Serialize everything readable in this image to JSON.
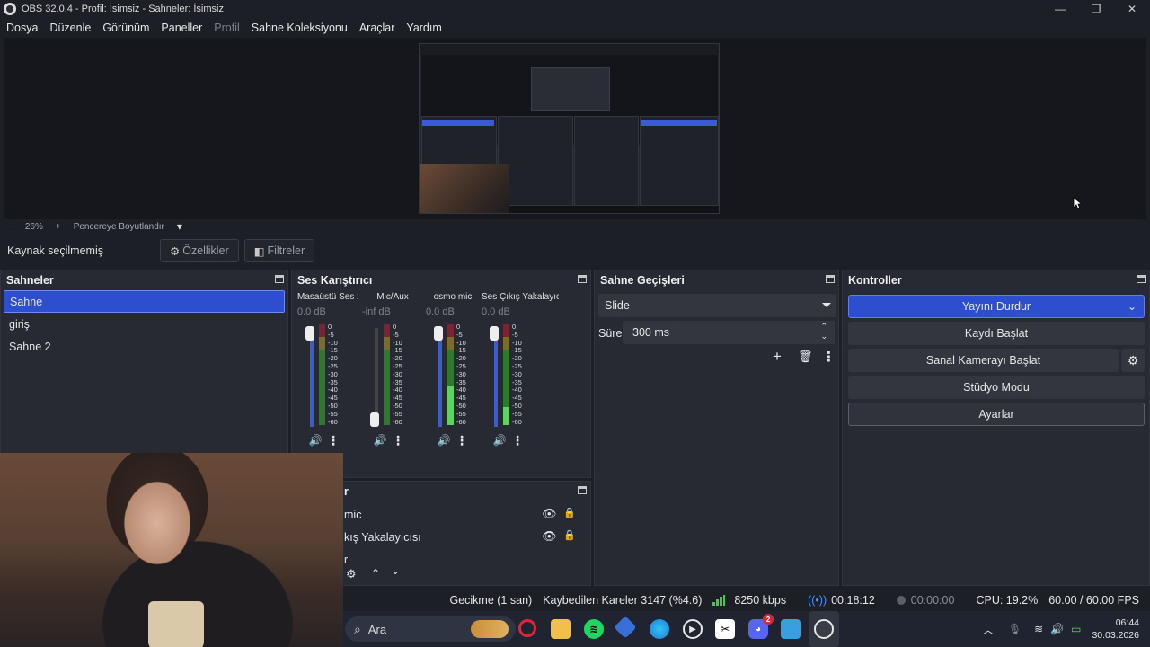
{
  "window": {
    "title": "OBS 32.0.4 - Profil: İsimsiz - Sahneler: İsimsiz",
    "minimize": "—",
    "maximize": "❐",
    "close": "✕"
  },
  "menu": {
    "items": [
      "Dosya",
      "Düzenle",
      "Görünüm",
      "Paneller",
      "Profil",
      "Sahne Koleksiyonu",
      "Araçlar",
      "Yardım"
    ]
  },
  "zoom": {
    "minus": "−",
    "value": "26%",
    "plus": "+",
    "fit_label": "Pencereye Boyutlandır",
    "dropdown": "▾"
  },
  "properties_bar": {
    "no_source": "Kaynak seçilmemiş",
    "properties_label": "Özellikler",
    "filters_label": "Filtreler"
  },
  "scenes": {
    "title": "Sahneler",
    "items": [
      "Sahne",
      "giriş",
      "Sahne 2"
    ],
    "selected_index": 0
  },
  "mixer": {
    "title": "Ses Karıştırıcı",
    "channels": [
      {
        "name": "Masaüstü Ses 2",
        "db": "0.0 dB",
        "level": 0.0,
        "slider": 1.0,
        "active": true
      },
      {
        "name": "Mic/Aux",
        "db": "-inf dB",
        "level": 0.0,
        "slider": 0.0,
        "active": false
      },
      {
        "name": "osmo mic",
        "db": "0.0 dB",
        "level": 0.38,
        "slider": 1.0,
        "active": true
      },
      {
        "name": "Ses Çıkış Yakalayıcısı",
        "db": "0.0 dB",
        "level": 0.18,
        "slider": 1.0,
        "active": true
      }
    ],
    "scale": [
      "0",
      "-5",
      "-10",
      "-15",
      "-20",
      "-25",
      "-30",
      "-35",
      "-40",
      "-45",
      "-50",
      "-55",
      "-60"
    ]
  },
  "sources": {
    "title": "r",
    "items": [
      "mic",
      "kış Yakalayıcısı",
      "r"
    ]
  },
  "transitions": {
    "title": "Sahne Geçişleri",
    "selected": "Slide",
    "duration_label": "Süre",
    "duration_value": "300 ms"
  },
  "controls": {
    "title": "Kontroller",
    "stop_stream": "Yayını Durdur",
    "start_recording": "Kaydı Başlat",
    "start_virtualcam": "Sanal Kamerayı Başlat",
    "studio_mode": "Stüdyo Modu",
    "settings": "Ayarlar"
  },
  "status": {
    "delay": "Gecikme (1 san)",
    "dropped": "Kaybedilen Kareler 3147 (%4.6)",
    "bitrate": "8250 kbps",
    "stream_time": "00:18:12",
    "record_time": "00:00:00",
    "cpu": "CPU: 19.2%",
    "fps": "60.00 / 60.00 FPS"
  },
  "taskbar": {
    "search_placeholder": "Ara",
    "time": "06:44",
    "date": "30.03.2026",
    "discord_badge": "2"
  },
  "colors": {
    "accent": "#2d4fcf",
    "background": "#1d1f26",
    "panel": "#272a33"
  }
}
